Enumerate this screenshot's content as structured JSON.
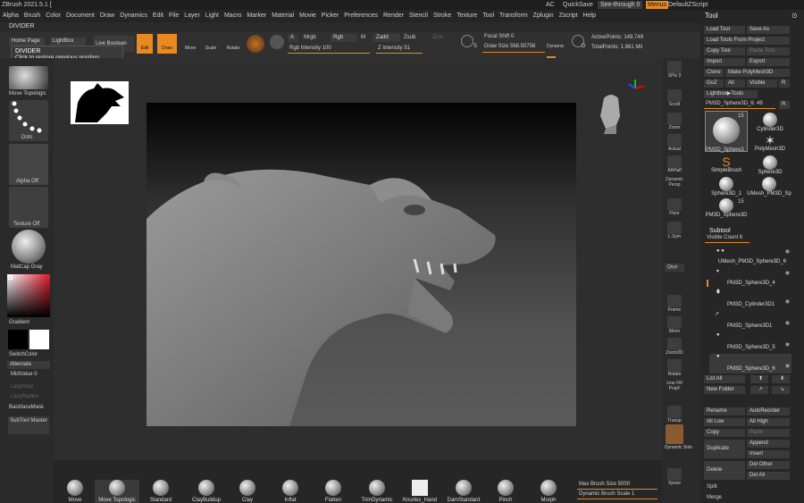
{
  "app": {
    "title": "ZBrush 2021.5.1 ["
  },
  "titlebar_right": {
    "ac": "AC",
    "quicksave": "QuickSave",
    "seethrough": "See-through  0",
    "menus": "Menus",
    "script": "DefaultZScript"
  },
  "menu": [
    "Alpha",
    "Brush",
    "Color",
    "Document",
    "Draw",
    "Dynamics",
    "Edit",
    "File",
    "Layer",
    "Light",
    "Macro",
    "Marker",
    "Material",
    "Movie",
    "Picker",
    "Preferences",
    "Render",
    "Stencil",
    "Stroke",
    "Texture",
    "Tool",
    "Transform",
    "Zplugin",
    "Zscript",
    "Help"
  ],
  "divider": {
    "label": "DIVIDER",
    "tooltip_title": "DIVIDER",
    "tooltip_text": "Click to restore previous position."
  },
  "toptray": {
    "homepage": "Home Page",
    "lightbox": "LightBox",
    "liveboolean": "Live Boolean",
    "edit": "Edit",
    "draw": "Draw",
    "move": "Move",
    "scale": "Scale",
    "rotate": "Rotate",
    "a": "A",
    "mrgb": "Mrgb",
    "rgb": "Rgb",
    "m": "M",
    "zadd": "Zadd",
    "zsub": "Zsub",
    "zcut": "Zcut",
    "rgb_intensity": "Rgb Intensity 100",
    "z_intensity": "Z Intensity 51",
    "focal_shift": "Focal Shift 0",
    "draw_size": "Draw Size 568.50756",
    "dynamic": "Dynamic",
    "active_points": "ActivePoints: 149,749",
    "total_points": "TotalPoints: 1.861 Mil",
    "s": "S",
    "d": "D"
  },
  "leftshelf": {
    "move_topo": "Move Topologic",
    "dots": "Dots",
    "alpha_off": "Alpha Off",
    "texture_off": "Texture Off",
    "matcap": "MatCap Gray",
    "gradient": "Gradient",
    "switchcolor": "SwitchColor",
    "alternate": "Alternate",
    "midvalue": "MidValue 0",
    "lazystep": "LazyStep",
    "lazyradius": "LazyRadius",
    "backface": "BackfaceMask",
    "subtool_master": "SubTool Master"
  },
  "rightshelf": [
    "SPix 3",
    "Scroll",
    "Zoom",
    "Actual",
    "AAHalf",
    "Dynamic Persp",
    "Floor",
    "L.Sym",
    "Frame",
    "Move",
    "Zoom3D",
    "Rotate",
    "Line Fill PolyF",
    "Transp",
    "Dynamic Solo",
    "Xpose"
  ],
  "rightshelf_extra": {
    "qxyz": "Qxyz"
  },
  "bottomshelf": {
    "brushes": [
      "Move",
      "Move Topologic",
      "Standard",
      "ClayBuildup",
      "Clay",
      "Inflat",
      "Flatten",
      "TrimDynamic",
      "Knurles_Hand",
      "DamStandard",
      "Pinch",
      "Morph"
    ],
    "max_brush": "Max Brush Size 5000",
    "dyn_brush": "Dynamic Brush Scale 1"
  },
  "toolpanel": {
    "title": "Tool",
    "buttons": [
      "Load Tool",
      "Save As",
      "Load Tools From Project",
      "Copy Tool",
      "Paste Tool",
      "Import",
      "Export",
      "Clone",
      "Make PolyMesh3D",
      "GoZ",
      "All",
      "Visible",
      "R",
      "Lightbox▶Tools"
    ],
    "current": "PM3D_Sphere3D_6. 49",
    "r2": "R",
    "thumbs": [
      "PM3D_Sphere3",
      "Cylinder3D",
      "PolyMesh3D",
      "SimpleBrush",
      "Sphere3D",
      "Sphere3D_1",
      "UMesh_PM3D_Sp",
      "PM3D_Sphere3D"
    ],
    "count15": "15",
    "count15b": "15",
    "subtool_title": "Subtool",
    "visible_count": "Visible Count 6",
    "subtools": [
      "UMesh_PM3D_Sphere3D_6",
      "PM3D_Sphere3D_4",
      "PM3D_Cylinder3D1",
      "PM3D_Sphere3D1",
      "PM3D_Sphere3D_5",
      "PM3D_Sphere3D_6"
    ],
    "list_all": "List All",
    "new_folder": "New Folder",
    "rename": "Rename",
    "autoreorder": "AutoReorder",
    "all_low": "All Low",
    "all_high": "All High",
    "copy": "Copy",
    "paste": "Paste",
    "duplicate": "Duplicate",
    "append": "Append",
    "insert": "Insert",
    "delete": "Delete",
    "del_other": "Del Other",
    "del_all": "Del All",
    "split": "Split",
    "merge": "Merge"
  }
}
